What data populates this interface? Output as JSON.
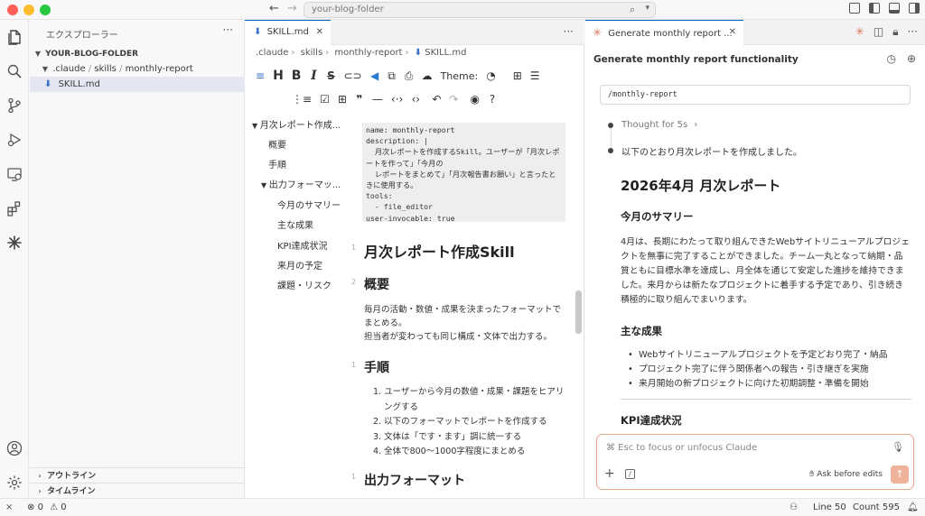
{
  "titlebar": {
    "search_text": "your-blog-folder",
    "nav_back": "←",
    "nav_forward": "→"
  },
  "activity_icons": [
    "files-icon",
    "search-icon",
    "source-control-icon",
    "run-debug-icon",
    "remote-explorer-icon",
    "extensions-icon",
    "claude-icon",
    "account-icon",
    "settings-icon"
  ],
  "sidebar": {
    "title": "エクスプローラー",
    "folder": "YOUR-BLOG-FOLDER",
    "path": [
      ".claude",
      "skills",
      "monthly-report"
    ],
    "file": "SKILL.md",
    "outline_label": "アウトライン",
    "timeline_label": "タイムライン"
  },
  "editor": {
    "tab_label": "SKILL.md",
    "breadcrumb": [
      ".claude",
      "skills",
      "monthly-report",
      "SKILL.md"
    ],
    "theme_label": "Theme:",
    "outline": [
      "月次レポート作成...",
      "概要",
      "手順",
      "出力フォーマッ...",
      "今月のサマリー",
      "主な成果",
      "KPI達成状況",
      "来月の予定",
      "課題・リスク"
    ],
    "frontmatter": "name: monthly-report\ndescription: |\n  月次レポートを作成するSkill。ユーザーが「月次レポ\nートを作って」「今月の\n  レポートをまとめて」「月次報告書お願い」と言ったと\nきに使用する。\ntools:\n  - file_editor\nuser-invocable: true",
    "line_numbers": [
      "1",
      "2",
      "1",
      "2",
      "1",
      "2"
    ],
    "h1": "月次レポート作成Skill",
    "h2_overview": "概要",
    "overview_text_1": "毎月の活動・数値・成果を決まったフォーマットで",
    "overview_text_2": "まとめる。",
    "overview_text_3": "担当者が変わっても同じ構成・文体で出力する。",
    "h2_steps": "手順",
    "steps": [
      "1. ユーザーから今月の数値・成果・課題をヒアリングする",
      "2. 以下のフォーマットでレポートを作成する",
      "3. 文体は「です・ます」調に統一する",
      "4. 全体で800〜1000字程度にまとめる"
    ],
    "h2_format": "出力フォーマット"
  },
  "claude": {
    "tab_label": "Generate monthly report ...",
    "header": "Generate monthly report functionality",
    "slash_command": "/monthly-report",
    "thought": "Thought for 5s",
    "thought_chevron": "›",
    "reply_intro": "以下のとおり月次レポートを作成しました。",
    "report_title": "2026年4月 月次レポート",
    "summary_heading": "今月のサマリー",
    "summary_text": "4月は、長期にわたって取り組んできたWebサイトリニューアルプロジェクトを無事に完了することができました。チーム一丸となって納期・品質ともに目標水準を達成し、月全体を通じて安定した進捗を維持できました。来月からは新たなプロジェクトに着手する予定であり、引き続き積極的に取り組んでまいります。",
    "achievements_heading": "主な成果",
    "achievements": [
      "Webサイトリニューアルプロジェクトを予定どおり完了・納品",
      "プロジェクト完了に伴う関係者への報告・引き継ぎを実施",
      "来月開始の新プロジェクトに向けた初期調整・準備を開始"
    ],
    "kpi_heading": "KPI達成状況",
    "input_placeholder": "⌘ Esc to focus or unfocus Claude",
    "ask_label": "Ask before edits"
  },
  "statusbar": {
    "errors": "0",
    "warnings": "0",
    "line": "Line 50",
    "count": "Count 595"
  },
  "colors": {
    "accent": "#005fb8",
    "claude_orange": "#d97757",
    "send_button": "#efb39c"
  }
}
